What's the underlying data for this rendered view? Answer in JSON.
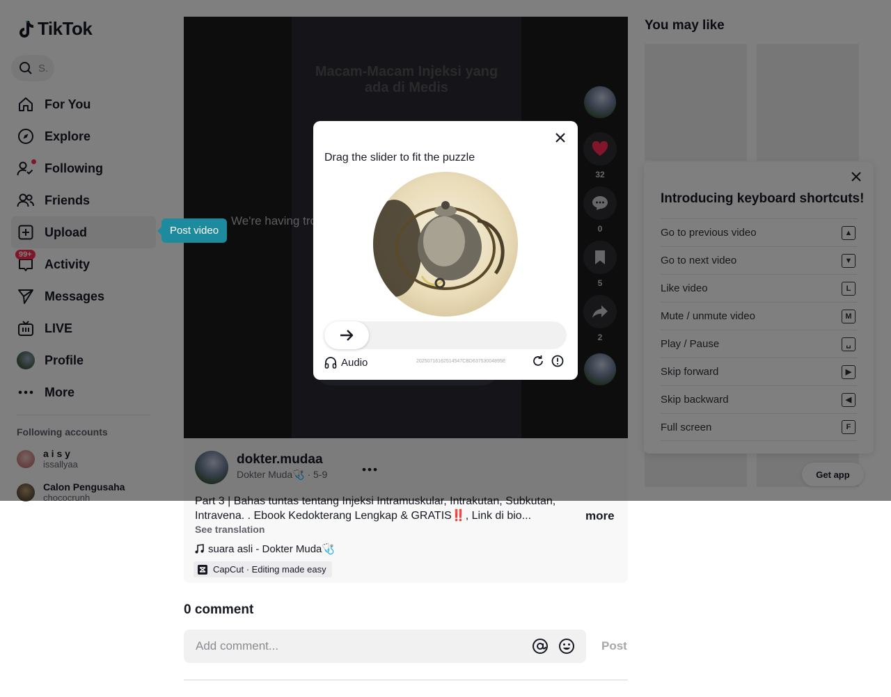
{
  "app": {
    "logo_text": "TikTok"
  },
  "search": {
    "placeholder": "S."
  },
  "nav": {
    "items": [
      {
        "label": "For You",
        "icon": "home-icon"
      },
      {
        "label": "Explore",
        "icon": "compass-icon"
      },
      {
        "label": "Following",
        "icon": "following-icon"
      },
      {
        "label": "Friends",
        "icon": "friends-icon"
      },
      {
        "label": "Upload",
        "icon": "upload-icon"
      },
      {
        "label": "Activity",
        "icon": "inbox-icon"
      },
      {
        "label": "Messages",
        "icon": "send-icon"
      },
      {
        "label": "LIVE",
        "icon": "live-icon"
      },
      {
        "label": "Profile",
        "icon": "avatar"
      },
      {
        "label": "More",
        "icon": "more-icon"
      }
    ],
    "activity_badge": "99+"
  },
  "tooltip": {
    "label": "Post video"
  },
  "following": {
    "title": "Following accounts",
    "accounts": [
      {
        "name": "a i s y",
        "handle": "issallyaa"
      },
      {
        "name": "Calon Pengusaha",
        "handle": "chococrunh"
      }
    ]
  },
  "video": {
    "error_text": "We're having tro",
    "title": "Macam-Macam Injeksi yang ada di Medis",
    "counts": {
      "likes": "32",
      "comments": "0",
      "saves": "5",
      "shares": "2"
    }
  },
  "post": {
    "author_name": "dokter.mudaa",
    "author_sub": "Dokter Muda🩺 · 5-9",
    "caption": "Part 3 | Bahas tuntas tentang Injeksi Intramuskular, Intrakutan, Subkutan, Intravena. . Ebook Kedokterang Lengkap & GRATIS‼️, Link di bio...",
    "more_label": "more",
    "see_translation": "See translation",
    "music": "suara asli - Dokter Muda🩺",
    "capcut": "CapCut · Editing made easy"
  },
  "comments": {
    "title": "0 comment",
    "placeholder": "Add comment...",
    "post_label": "Post"
  },
  "right": {
    "you_may_like": "You may like",
    "get_app": "Get app"
  },
  "shortcuts": {
    "title": "Introducing keyboard shortcuts!",
    "rows": [
      {
        "label": "Go to previous video",
        "key": "▲"
      },
      {
        "label": "Go to next video",
        "key": "▼"
      },
      {
        "label": "Like video",
        "key": "L"
      },
      {
        "label": "Mute / unmute video",
        "key": "M"
      },
      {
        "label": "Play / Pause",
        "key": "␣"
      },
      {
        "label": "Skip forward",
        "key": "▶"
      },
      {
        "label": "Skip backward",
        "key": "◀"
      },
      {
        "label": "Full screen",
        "key": "F"
      }
    ]
  },
  "captcha": {
    "title": "Drag the slider to fit the puzzle",
    "audio_label": "Audio",
    "id_text": "20250716162514547CBD63753004895E"
  },
  "colors": {
    "brand_red": "#fe2c55",
    "tooltip_teal": "#1e8a9e"
  }
}
